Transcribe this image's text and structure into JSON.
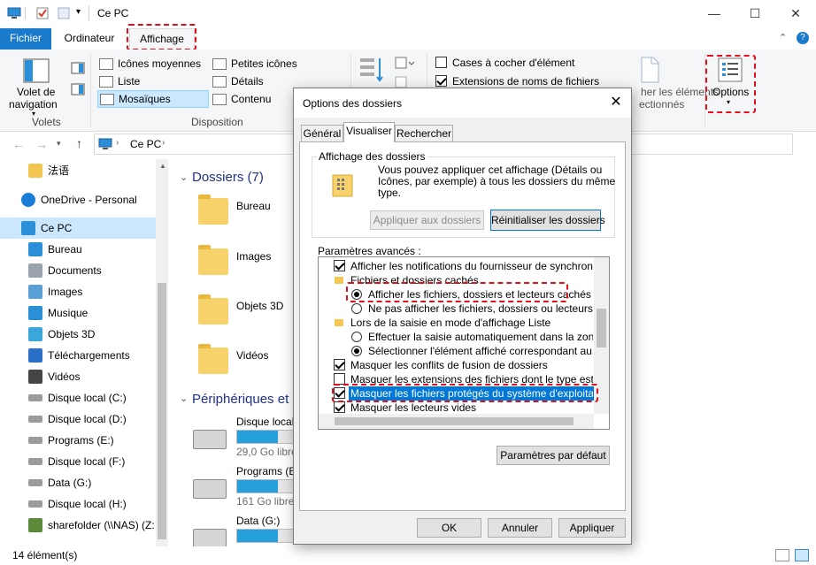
{
  "window": {
    "title": "Ce PC",
    "controls": {
      "minimize": "—",
      "maximize": "☐",
      "close": "✕"
    }
  },
  "ribbon_tabs": {
    "file": "Fichier",
    "computer": "Ordinateur",
    "view": "Affichage"
  },
  "ribbon": {
    "nav_pane_label1": "Volet de",
    "nav_pane_label2": "navigation",
    "panes_group": "Volets",
    "layout_items": {
      "medium_icons": "Icônes moyennes",
      "small_icons": "Petites icônes",
      "list": "Liste",
      "details": "Détails",
      "tiles": "Mosaïques",
      "content": "Contenu"
    },
    "layout_group": "Disposition",
    "item_checkboxes": "Cases à cocher d'élément",
    "file_extensions": "Extensions de noms de fichiers",
    "hide_selected1": "her les éléments",
    "hide_selected2": "ectionnés",
    "options": "Options"
  },
  "address": {
    "path": "Ce PC"
  },
  "nav": [
    {
      "label": "法语",
      "icon": "folder-check-icon"
    },
    {
      "label": "OneDrive - Personal",
      "icon": "cloud-icon"
    },
    {
      "label": "Ce PC",
      "icon": "computer-icon"
    },
    {
      "label": "Bureau",
      "icon": "desktop-icon"
    },
    {
      "label": "Documents",
      "icon": "documents-icon"
    },
    {
      "label": "Images",
      "icon": "images-icon"
    },
    {
      "label": "Musique",
      "icon": "music-icon"
    },
    {
      "label": "Objets 3D",
      "icon": "cube-icon"
    },
    {
      "label": "Téléchargements",
      "icon": "download-icon"
    },
    {
      "label": "Vidéos",
      "icon": "video-icon"
    },
    {
      "label": "Disque local (C:)",
      "icon": "drive-icon"
    },
    {
      "label": "Disque local (D:)",
      "icon": "drive-icon"
    },
    {
      "label": "Programs (E:)",
      "icon": "drive-icon"
    },
    {
      "label": "Disque local (F:)",
      "icon": "drive-icon"
    },
    {
      "label": "Data (G:)",
      "icon": "drive-icon"
    },
    {
      "label": "Disque local (H:)",
      "icon": "drive-icon"
    },
    {
      "label": "sharefolder (\\\\NAS) (Z:",
      "icon": "network-drive-icon"
    }
  ],
  "content": {
    "folders_header": "Dossiers (7)",
    "folders": [
      "Bureau",
      "Images",
      "Objets 3D",
      "Vidéos"
    ],
    "devices_header": "Périphériques et le",
    "drives": [
      {
        "name": "Disque local",
        "free": "29,0 Go libre",
        "used_fraction": 0.72
      },
      {
        "name": "Programs (E",
        "free": "161 Go libres",
        "used_fraction": 0.72
      },
      {
        "name": "Data (G:)",
        "free": "",
        "used_fraction": 0.72
      }
    ]
  },
  "status": {
    "count": "14 élément(s)"
  },
  "dialog": {
    "title": "Options des dossiers",
    "tabs": [
      "Général",
      "Visualiser",
      "Rechercher"
    ],
    "folder_view_group": "Affichage des dossiers",
    "folder_view_desc1": "Vous pouvez appliquer cet affichage (Détails ou",
    "folder_view_desc2": "Icônes, par exemple) à tous les dossiers du même",
    "folder_view_desc3": "type.",
    "apply_folders": "Appliquer aux dossiers",
    "reset_folders": "Réinitialiser les dossiers",
    "advanced_label": "Paramètres avancés :",
    "advanced": [
      {
        "text": "Afficher les notifications du fournisseur de synchronisation",
        "control": "checkbox",
        "checked": true
      },
      {
        "text": "Fichiers et dossiers cachés",
        "control": "folder"
      },
      {
        "text": "Afficher les fichiers, dossiers et lecteurs cachés",
        "control": "radio",
        "checked": true
      },
      {
        "text": "Ne pas afficher les fichiers, dossiers ou lecteurs caché",
        "control": "radio",
        "checked": false
      },
      {
        "text": "Lors de la saisie en mode d'affichage Liste",
        "control": "folder"
      },
      {
        "text": "Effectuer la saisie automatiquement dans la zone Rech",
        "control": "radio",
        "checked": false
      },
      {
        "text": "Sélectionner l'élément affiché correspondant au texte s",
        "control": "radio",
        "checked": true
      },
      {
        "text": "Masquer les conflits de fusion de dossiers",
        "control": "checkbox",
        "checked": true
      },
      {
        "text": "Masquer les extensions des fichiers dont le type est connu",
        "control": "checkbox",
        "checked": false
      },
      {
        "text": "Masquer les fichiers protégés du système d'exploitation (re",
        "control": "checkbox",
        "checked": true,
        "selected": true
      },
      {
        "text": "Masquer les lecteurs vides",
        "control": "checkbox",
        "checked": true
      }
    ],
    "defaults": "Paramètres par défaut",
    "ok": "OK",
    "cancel": "Annuler",
    "apply": "Appliquer"
  },
  "colors": {
    "accent": "#1979ca",
    "selection": "#0078d7",
    "highlight": "#e0101f"
  }
}
